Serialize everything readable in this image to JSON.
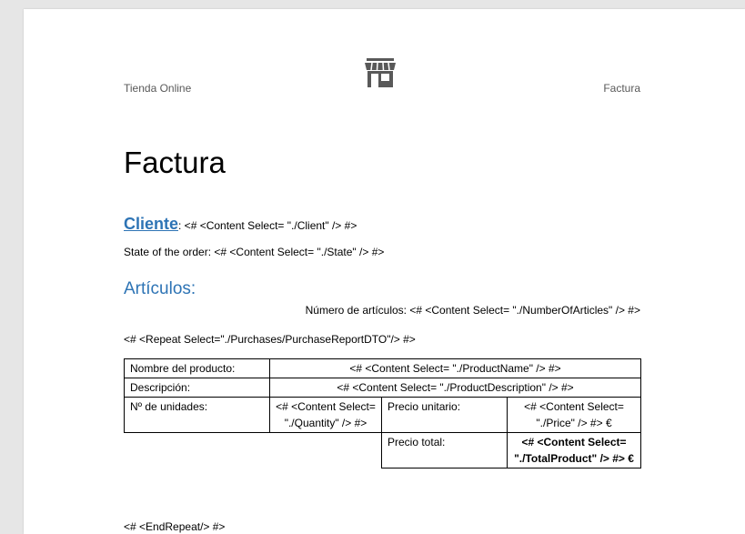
{
  "header": {
    "left": "Tienda Online",
    "right": "Factura",
    "logo_icon": "store-icon",
    "logo_color": "#595959"
  },
  "title": "Factura",
  "client": {
    "label": "Cliente",
    "value": ": <# <Content Select= \"./Client\" /> #>"
  },
  "state_line": "State of the order: <# <Content Select= \"./State\" /> #>",
  "articles_heading": "Artículos:",
  "number_of_articles": "Número de artículos: <# <Content Select= \"./NumberOfArticles\" /> #>",
  "repeat_start": "<# <Repeat Select=\"./Purchases/PurchaseReportDTO\"/> #>",
  "table": {
    "name_label": "Nombre del producto:",
    "name_value": "<# <Content Select= \"./ProductName\" /> #>",
    "desc_label": "Descripción:",
    "desc_value": "<# <Content Select= \"./ProductDescription\" /> #>",
    "units_label": "Nº de unidades:",
    "units_value": "<# <Content Select= \"./Quantity\" /> #>",
    "unit_price_label": "Precio unitario:",
    "unit_price_value": "<# <Content Select= \"./Price\" /> #> €",
    "total_label": "Precio total:",
    "total_value": "<# <Content Select= \"./TotalProduct\" /> #> €"
  },
  "repeat_end": "<# <EndRepeat/> #>",
  "colors": {
    "heading_blue": "#2e74b5",
    "header_gray": "#595959"
  }
}
